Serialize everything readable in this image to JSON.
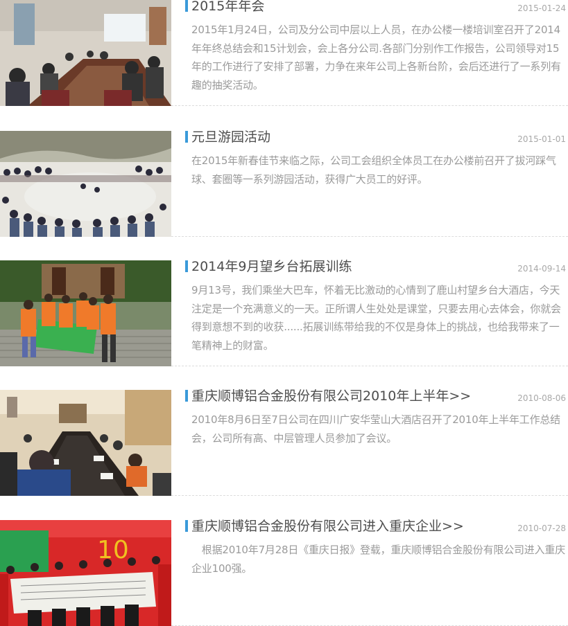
{
  "news": [
    {
      "title": "2015年年会",
      "date": "2015-01-24",
      "summary": "2015年1月24日，公司及分公司中层以上人员，在办公楼一楼培训室召开了2014年年终总结会和15计划会，会上各分公司.各部门分别作工作报告，公司领导对15年的工作进行了安排了部署，力争在来年公司上各新台阶，会后还进行了一系列有趣的抽奖活动。",
      "image": "meeting-room-photo"
    },
    {
      "title": "元旦游园活动",
      "date": "2015-01-01",
      "summary": "在2015年新春佳节来临之际，公司工会组织全体员工在办公楼前召开了拔河踩气球、套圈等一系列游园活动，获得广大员工的好评。",
      "image": "crowd-outdoor-photo"
    },
    {
      "title": "2014年9月望乡台拓展训练",
      "date": "2014-09-14",
      "summary": "9月13号，我们乘坐大巴车，怀着无比激动的心情到了鹿山村望乡台大酒店，今天注定是一个充满意义的一天。正所谓人生处处是课堂，只要去用心去体会，你就会得到意想不到的收获......拓展训练带给我的不仅是身体上的挑战，也给我带来了一笔精神上的财富。",
      "image": "team-flag-photo"
    },
    {
      "title": "重庆顺博铝合金股份有限公司2010年上半年>>",
      "date": "2010-08-06",
      "summary": "2010年8月6日至7日公司在四川广安华莹山大酒店召开了2010年上半年工作总结会，公司所有高、中层管理人员参加了会议。",
      "image": "conference-table-photo"
    },
    {
      "title": "重庆顺博铝合金股份有限公司进入重庆企业>>",
      "date": "2010-07-28",
      "summary": "　根据2010年7月28日《重庆日报》登载，重庆顺博铝合金股份有限公司进入重庆企业100强。",
      "image": "banner-ceremony-photo"
    }
  ],
  "colors": {
    "accent": "#3a9ad9",
    "title": "#4d4d4d",
    "summary": "#9a9a9a",
    "date": "#a8a8a8"
  }
}
